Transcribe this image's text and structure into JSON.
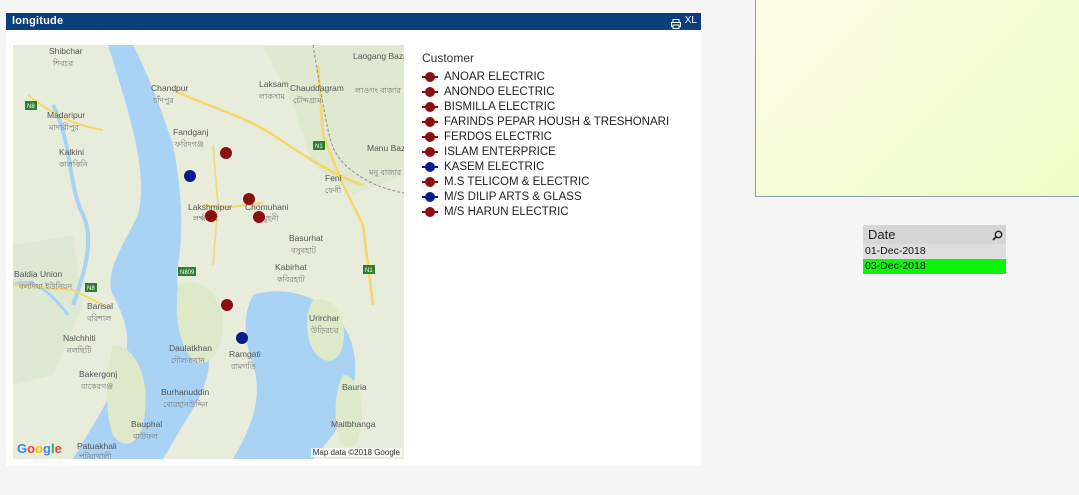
{
  "chart": {
    "title": "longitude",
    "xl_label": "XL",
    "legend_title": "Customer",
    "legend": [
      {
        "label": "ANOAR ELECTRIC",
        "color": "#8b0f0f"
      },
      {
        "label": "ANONDO ELECTRIC",
        "color": "#8b0f0f"
      },
      {
        "label": "BISMILLA ELECTRIC",
        "color": "#8b0f0f"
      },
      {
        "label": "FARINDS PEPAR HOUSH & TRESHONARI",
        "color": "#8b0f0f"
      },
      {
        "label": "FERDOS ELECTRIC",
        "color": "#8b0f0f"
      },
      {
        "label": "ISLAM ENTERPRICE",
        "color": "#8b0f0f"
      },
      {
        "label": "KASEM ELECTRIC",
        "color": "#0c1a8a"
      },
      {
        "label": "M.S TELICOM & ELECTRIC",
        "color": "#8b0f0f"
      },
      {
        "label": "M/S DILIP ARTS & GLASS",
        "color": "#0c1a8a"
      },
      {
        "label": "M/S HARUN ELECTRIC",
        "color": "#8b0f0f"
      }
    ],
    "map": {
      "places": [
        {
          "name": "Shibchar",
          "bn": "শিবচর"
        },
        {
          "name": "Madaripur",
          "bn": "মাদারীপুর"
        },
        {
          "name": "Kalkini",
          "bn": "কালকিনি"
        },
        {
          "name": "Chandpur",
          "bn": "চাঁদপুর"
        },
        {
          "name": "Fandganj",
          "bn": "ফরিদগঞ্জ"
        },
        {
          "name": "Laksam",
          "bn": "লাকসাম"
        },
        {
          "name": "Chauddagram",
          "bn": "চৌদ্দগ্রাম"
        },
        {
          "name": "Laogang Bazaar",
          "bn": "লাওগং বাজার"
        },
        {
          "name": "Manu Bazar",
          "bn": "মনু বাজার"
        },
        {
          "name": "Feni",
          "bn": "ফেনী"
        },
        {
          "name": "Lakshmipur",
          "bn": "লক্ষ্মীপুর"
        },
        {
          "name": "Chomuhani",
          "bn": "চৌমুহনী"
        },
        {
          "name": "Basurhat",
          "bn": "বসুরহাট"
        },
        {
          "name": "Kabirhat",
          "bn": "কবিরহাট"
        },
        {
          "name": "Baldia Union",
          "bn": "বলদিয়া ইউনিয়ন"
        },
        {
          "name": "Barisal",
          "bn": "বরিশাল"
        },
        {
          "name": "Nalchhiti",
          "bn": "নলছিটি"
        },
        {
          "name": "Urirchar",
          "bn": "উড়িরচর"
        },
        {
          "name": "Daulatkhan",
          "bn": "দৌলতখান"
        },
        {
          "name": "Ramgati",
          "bn": "রামগতি"
        },
        {
          "name": "Bakergonj",
          "bn": "বাকেরগঞ্জ"
        },
        {
          "name": "Burhanuddin",
          "bn": "বোরহানউদ্দিন"
        },
        {
          "name": "Bauria",
          "bn": ""
        },
        {
          "name": "Bauphal",
          "bn": "বাউফল"
        },
        {
          "name": "Maitbhanga",
          "bn": ""
        },
        {
          "name": "Patuakhali",
          "bn": "পটুয়াখালী"
        }
      ],
      "roads": [
        "N8",
        "N8",
        "N1",
        "N1",
        "N809"
      ],
      "points": [
        {
          "customer": "ANOAR ELECTRIC",
          "color": "#8b0f0f"
        },
        {
          "customer": "KASEM ELECTRIC",
          "color": "#0c1a8a"
        },
        {
          "customer": "ANONDO ELECTRIC",
          "color": "#8b0f0f"
        },
        {
          "customer": "BISMILLA ELECTRIC",
          "color": "#8b0f0f"
        },
        {
          "customer": "FARINDS PEPAR HOUSH & TRESHONARI",
          "color": "#8b0f0f"
        },
        {
          "customer": "FERDOS ELECTRIC",
          "color": "#8b0f0f"
        },
        {
          "customer": "M/S DILIP ARTS & GLASS",
          "color": "#0c1a8a"
        }
      ],
      "copyright": "Map data ©2018 Google",
      "google_logo": [
        "G",
        "o",
        "o",
        "g",
        "l",
        "e"
      ]
    }
  },
  "date_box": {
    "title": "Date",
    "rows": [
      {
        "value": "01-Dec-2018",
        "state": "excluded"
      },
      {
        "value": "03-Dec-2018",
        "state": "selected"
      }
    ]
  },
  "colors": {
    "titlebar": "#0b3e7c",
    "selected": "#0ef40e",
    "customer_red": "#8b0f0f",
    "customer_blue": "#0c1a8a"
  }
}
